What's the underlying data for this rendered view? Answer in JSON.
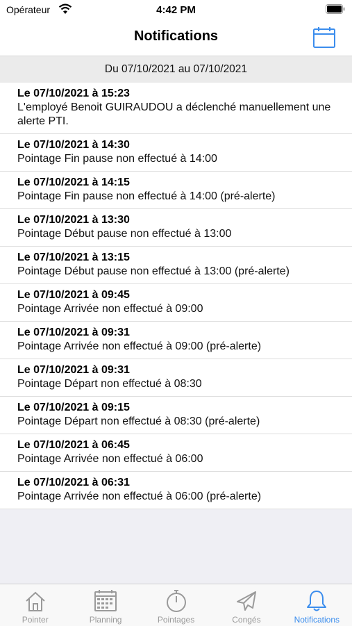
{
  "status_bar": {
    "carrier": "Opérateur",
    "time": "4:42 PM"
  },
  "header": {
    "title": "Notifications",
    "action_icon": "calendar-icon"
  },
  "date_range": "Du 07/10/2021 au 07/10/2021",
  "notifications": [
    {
      "date": "Le 07/10/2021 à 15:23",
      "text": "L'employé Benoit GUIRAUDOU a déclenché manuellement une alerte PTI."
    },
    {
      "date": "Le 07/10/2021 à 14:30",
      "text": "Pointage Fin pause non effectué à 14:00"
    },
    {
      "date": "Le 07/10/2021 à 14:15",
      "text": "Pointage Fin pause non effectué à 14:00 (pré-alerte)"
    },
    {
      "date": "Le 07/10/2021 à 13:30",
      "text": "Pointage Début pause non effectué à 13:00"
    },
    {
      "date": "Le 07/10/2021 à 13:15",
      "text": "Pointage Début pause non effectué à 13:00 (pré-alerte)"
    },
    {
      "date": "Le 07/10/2021 à 09:45",
      "text": "Pointage Arrivée non effectué à 09:00"
    },
    {
      "date": "Le 07/10/2021 à 09:31",
      "text": "Pointage Arrivée non effectué à 09:00 (pré-alerte)"
    },
    {
      "date": "Le 07/10/2021 à 09:31",
      "text": "Pointage Départ non effectué à 08:30"
    },
    {
      "date": "Le 07/10/2021 à 09:15",
      "text": "Pointage Départ non effectué à 08:30 (pré-alerte)"
    },
    {
      "date": "Le 07/10/2021 à 06:45",
      "text": "Pointage Arrivée non effectué à 06:00"
    },
    {
      "date": "Le 07/10/2021 à 06:31",
      "text": "Pointage Arrivée non effectué à 06:00 (pré-alerte)"
    }
  ],
  "tabs": [
    {
      "label": "Pointer",
      "icon": "house-icon"
    },
    {
      "label": "Planning",
      "icon": "calendar-grid-icon"
    },
    {
      "label": "Pointages",
      "icon": "stopwatch-icon"
    },
    {
      "label": "Congés",
      "icon": "airplane-icon"
    },
    {
      "label": "Notifications",
      "icon": "bell-icon",
      "active": true
    }
  ],
  "colors": {
    "accent": "#3b8ded",
    "inactive": "#9a9a9a"
  }
}
